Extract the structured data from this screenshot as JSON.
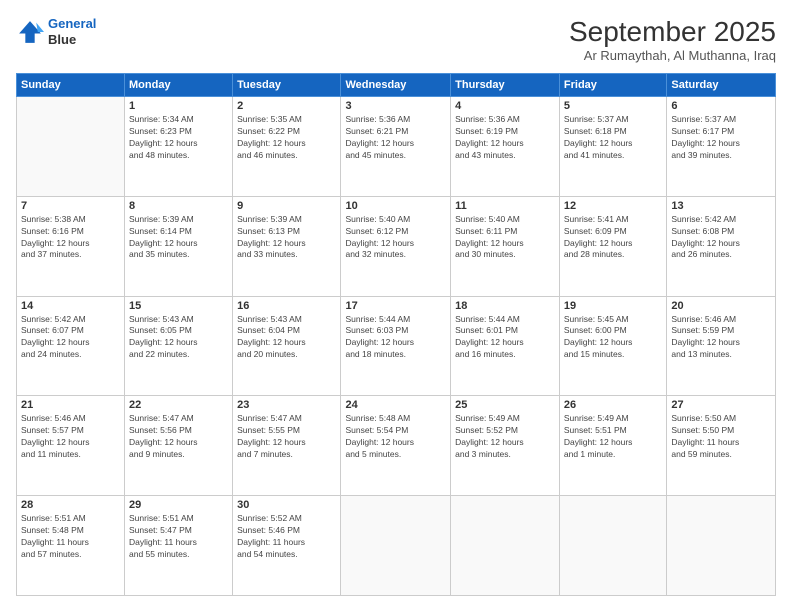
{
  "header": {
    "logo_line1": "General",
    "logo_line2": "Blue",
    "title": "September 2025",
    "subtitle": "Ar Rumaythah, Al Muthanna, Iraq"
  },
  "days_of_week": [
    "Sunday",
    "Monday",
    "Tuesday",
    "Wednesday",
    "Thursday",
    "Friday",
    "Saturday"
  ],
  "weeks": [
    [
      {
        "day": "",
        "info": ""
      },
      {
        "day": "1",
        "info": "Sunrise: 5:34 AM\nSunset: 6:23 PM\nDaylight: 12 hours\nand 48 minutes."
      },
      {
        "day": "2",
        "info": "Sunrise: 5:35 AM\nSunset: 6:22 PM\nDaylight: 12 hours\nand 46 minutes."
      },
      {
        "day": "3",
        "info": "Sunrise: 5:36 AM\nSunset: 6:21 PM\nDaylight: 12 hours\nand 45 minutes."
      },
      {
        "day": "4",
        "info": "Sunrise: 5:36 AM\nSunset: 6:19 PM\nDaylight: 12 hours\nand 43 minutes."
      },
      {
        "day": "5",
        "info": "Sunrise: 5:37 AM\nSunset: 6:18 PM\nDaylight: 12 hours\nand 41 minutes."
      },
      {
        "day": "6",
        "info": "Sunrise: 5:37 AM\nSunset: 6:17 PM\nDaylight: 12 hours\nand 39 minutes."
      }
    ],
    [
      {
        "day": "7",
        "info": "Sunrise: 5:38 AM\nSunset: 6:16 PM\nDaylight: 12 hours\nand 37 minutes."
      },
      {
        "day": "8",
        "info": "Sunrise: 5:39 AM\nSunset: 6:14 PM\nDaylight: 12 hours\nand 35 minutes."
      },
      {
        "day": "9",
        "info": "Sunrise: 5:39 AM\nSunset: 6:13 PM\nDaylight: 12 hours\nand 33 minutes."
      },
      {
        "day": "10",
        "info": "Sunrise: 5:40 AM\nSunset: 6:12 PM\nDaylight: 12 hours\nand 32 minutes."
      },
      {
        "day": "11",
        "info": "Sunrise: 5:40 AM\nSunset: 6:11 PM\nDaylight: 12 hours\nand 30 minutes."
      },
      {
        "day": "12",
        "info": "Sunrise: 5:41 AM\nSunset: 6:09 PM\nDaylight: 12 hours\nand 28 minutes."
      },
      {
        "day": "13",
        "info": "Sunrise: 5:42 AM\nSunset: 6:08 PM\nDaylight: 12 hours\nand 26 minutes."
      }
    ],
    [
      {
        "day": "14",
        "info": "Sunrise: 5:42 AM\nSunset: 6:07 PM\nDaylight: 12 hours\nand 24 minutes."
      },
      {
        "day": "15",
        "info": "Sunrise: 5:43 AM\nSunset: 6:05 PM\nDaylight: 12 hours\nand 22 minutes."
      },
      {
        "day": "16",
        "info": "Sunrise: 5:43 AM\nSunset: 6:04 PM\nDaylight: 12 hours\nand 20 minutes."
      },
      {
        "day": "17",
        "info": "Sunrise: 5:44 AM\nSunset: 6:03 PM\nDaylight: 12 hours\nand 18 minutes."
      },
      {
        "day": "18",
        "info": "Sunrise: 5:44 AM\nSunset: 6:01 PM\nDaylight: 12 hours\nand 16 minutes."
      },
      {
        "day": "19",
        "info": "Sunrise: 5:45 AM\nSunset: 6:00 PM\nDaylight: 12 hours\nand 15 minutes."
      },
      {
        "day": "20",
        "info": "Sunrise: 5:46 AM\nSunset: 5:59 PM\nDaylight: 12 hours\nand 13 minutes."
      }
    ],
    [
      {
        "day": "21",
        "info": "Sunrise: 5:46 AM\nSunset: 5:57 PM\nDaylight: 12 hours\nand 11 minutes."
      },
      {
        "day": "22",
        "info": "Sunrise: 5:47 AM\nSunset: 5:56 PM\nDaylight: 12 hours\nand 9 minutes."
      },
      {
        "day": "23",
        "info": "Sunrise: 5:47 AM\nSunset: 5:55 PM\nDaylight: 12 hours\nand 7 minutes."
      },
      {
        "day": "24",
        "info": "Sunrise: 5:48 AM\nSunset: 5:54 PM\nDaylight: 12 hours\nand 5 minutes."
      },
      {
        "day": "25",
        "info": "Sunrise: 5:49 AM\nSunset: 5:52 PM\nDaylight: 12 hours\nand 3 minutes."
      },
      {
        "day": "26",
        "info": "Sunrise: 5:49 AM\nSunset: 5:51 PM\nDaylight: 12 hours\nand 1 minute."
      },
      {
        "day": "27",
        "info": "Sunrise: 5:50 AM\nSunset: 5:50 PM\nDaylight: 11 hours\nand 59 minutes."
      }
    ],
    [
      {
        "day": "28",
        "info": "Sunrise: 5:51 AM\nSunset: 5:48 PM\nDaylight: 11 hours\nand 57 minutes."
      },
      {
        "day": "29",
        "info": "Sunrise: 5:51 AM\nSunset: 5:47 PM\nDaylight: 11 hours\nand 55 minutes."
      },
      {
        "day": "30",
        "info": "Sunrise: 5:52 AM\nSunset: 5:46 PM\nDaylight: 11 hours\nand 54 minutes."
      },
      {
        "day": "",
        "info": ""
      },
      {
        "day": "",
        "info": ""
      },
      {
        "day": "",
        "info": ""
      },
      {
        "day": "",
        "info": ""
      }
    ]
  ]
}
